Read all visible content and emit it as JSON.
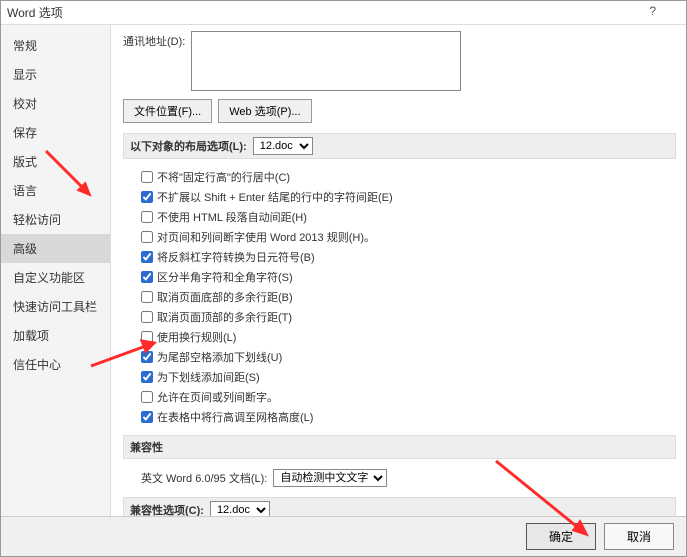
{
  "window": {
    "title": "Word 选项",
    "help": "?"
  },
  "sidebar": {
    "items": [
      {
        "label": "常规"
      },
      {
        "label": "显示"
      },
      {
        "label": "校对"
      },
      {
        "label": "保存"
      },
      {
        "label": "版式"
      },
      {
        "label": "语言"
      },
      {
        "label": "轻松访问"
      },
      {
        "label": "高级"
      },
      {
        "label": "自定义功能区"
      },
      {
        "label": "快速访问工具栏"
      },
      {
        "label": "加载项"
      },
      {
        "label": "信任中心"
      }
    ],
    "selected_index": 7
  },
  "address": {
    "label": "通讯地址(D):",
    "value": ""
  },
  "toolbar": {
    "file_locations": "文件位置(F)...",
    "web_options": "Web 选项(P)..."
  },
  "layout_section": {
    "label": "以下对象的布局选项(L):",
    "doc": "12.doc"
  },
  "layout_options": [
    {
      "checked": false,
      "label": "不将\"固定行高\"的行居中(C)"
    },
    {
      "checked": true,
      "label": "不扩展以 Shift + Enter 结尾的行中的字符间距(E)"
    },
    {
      "checked": false,
      "label": "不使用 HTML 段落自动间距(H)"
    },
    {
      "checked": false,
      "label": "对页间和列间断字使用 Word 2013 规则(H)。"
    },
    {
      "checked": true,
      "label": "将反斜杠字符转换为日元符号(B)"
    },
    {
      "checked": true,
      "label": "区分半角字符和全角字符(S)"
    },
    {
      "checked": false,
      "label": "取消页面底部的多余行距(B)"
    },
    {
      "checked": false,
      "label": "取消页面顶部的多余行距(T)"
    },
    {
      "checked": false,
      "label": "使用换行规则(L)"
    },
    {
      "checked": true,
      "label": "为尾部空格添加下划线(U)"
    },
    {
      "checked": true,
      "label": "为下划线添加间距(S)"
    },
    {
      "checked": false,
      "label": "允许在页间或列间断字。"
    },
    {
      "checked": true,
      "label": "在表格中将行高调至网格高度(L)"
    }
  ],
  "compat_heading": "兼容性",
  "compat": {
    "doc_label": "英文 Word 6.0/95 文档(L):",
    "doc_mode": "自动检测中文文字"
  },
  "compat_section": {
    "label": "兼容性选项(C):",
    "doc": "12.doc"
  },
  "buttons": {
    "ok": "确定",
    "cancel": "取消"
  }
}
